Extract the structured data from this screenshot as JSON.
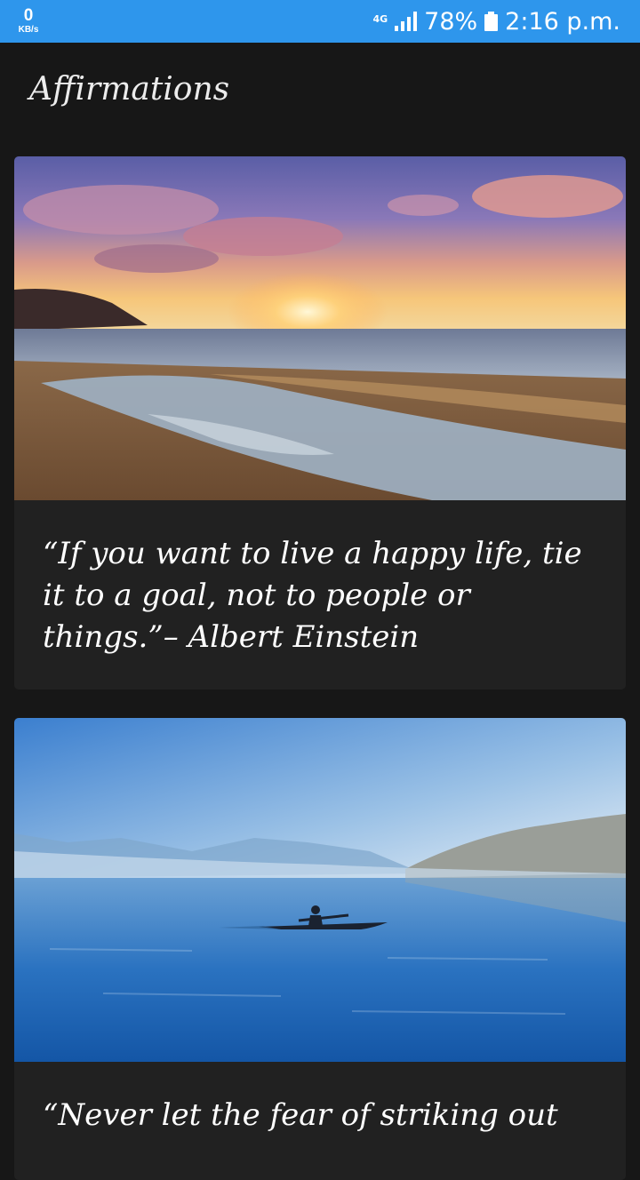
{
  "status_bar": {
    "net_speed_value": "0",
    "net_speed_unit": "KB/s",
    "network_type": "4G",
    "battery": "78%",
    "time": "2:16 p.m.",
    "background_color": "#2e96ec"
  },
  "app": {
    "title": "Affirmations"
  },
  "cards": [
    {
      "image_icon": "sunset-beach-image",
      "quote": "“If you want to live a happy life, tie it to a goal, not to people or things.”– Albert Einstein"
    },
    {
      "image_icon": "lake-kayak-image",
      "quote": "“Never let the fear of striking out"
    }
  ],
  "colors": {
    "background": "#171717",
    "card": "#212121",
    "text": "#ffffff"
  }
}
